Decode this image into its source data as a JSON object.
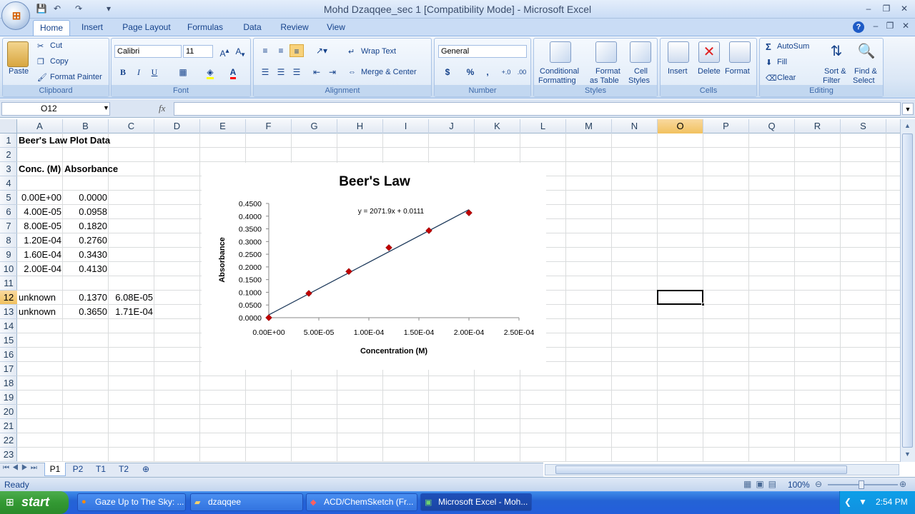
{
  "window": {
    "title": "Mohd Dzaqqee_sec 1  [Compatibility Mode] - Microsoft Excel"
  },
  "tabs": [
    "Home",
    "Insert",
    "Page Layout",
    "Formulas",
    "Data",
    "Review",
    "View"
  ],
  "ribbon": {
    "clipboard": {
      "label": "Clipboard",
      "paste": "Paste",
      "cut": "Cut",
      "copy": "Copy",
      "format_painter": "Format Painter"
    },
    "font": {
      "label": "Font",
      "name": "Calibri",
      "size": "11",
      "bold": "B",
      "italic": "I",
      "underline": "U"
    },
    "alignment": {
      "label": "Alignment",
      "wrap": "Wrap Text",
      "merge": "Merge & Center"
    },
    "number": {
      "label": "Number",
      "format": "General",
      "currency": "$",
      "percent": "%",
      "comma": ","
    },
    "styles": {
      "label": "Styles",
      "conditional1": "Conditional",
      "conditional2": "Formatting",
      "format_table1": "Format",
      "format_table2": "as Table",
      "cell_styles1": "Cell",
      "cell_styles2": "Styles"
    },
    "cells": {
      "label": "Cells",
      "insert": "Insert",
      "delete": "Delete",
      "format": "Format"
    },
    "editing": {
      "label": "Editing",
      "autosum": "AutoSum",
      "fill": "Fill",
      "clear": "Clear",
      "sort1": "Sort &",
      "sort2": "Filter",
      "find1": "Find &",
      "find2": "Select"
    }
  },
  "formula_bar": {
    "name_box": "O12",
    "fx": "fx",
    "value": ""
  },
  "columns": [
    "A",
    "B",
    "C",
    "D",
    "E",
    "F",
    "G",
    "H",
    "I",
    "J",
    "K",
    "L",
    "M",
    "N",
    "O",
    "P",
    "Q",
    "R",
    "S"
  ],
  "rows": [
    "1",
    "2",
    "3",
    "4",
    "5",
    "6",
    "7",
    "8",
    "9",
    "10",
    "11",
    "12",
    "13",
    "14",
    "15",
    "16",
    "17",
    "18",
    "19",
    "20",
    "21",
    "22",
    "23"
  ],
  "cells": {
    "a1": "Beer's Law Plot Data",
    "a3": "Conc. (M)",
    "b3": "Absorbance",
    "a5": "0.00E+00",
    "b5": "0.0000",
    "a6": "4.00E-05",
    "b6": "0.0958",
    "a7": "8.00E-05",
    "b7": "0.1820",
    "a8": "1.20E-04",
    "b8": "0.2760",
    "a9": "1.60E-04",
    "b9": "0.3430",
    "a10": "2.00E-04",
    "b10": "0.4130",
    "a12": "unknown",
    "b12": "0.1370",
    "c12": "6.08E-05",
    "a13": "unknown",
    "b13": "0.3650",
    "c13": "1.71E-04"
  },
  "chart_data": {
    "type": "scatter",
    "title": "Beer's Law",
    "xlabel": "Concentration (M)",
    "ylabel": "Absorbance",
    "x": [
      0,
      4e-05,
      8e-05,
      0.00012,
      0.00016,
      0.0002
    ],
    "y": [
      0,
      0.0958,
      0.182,
      0.276,
      0.343,
      0.413
    ],
    "xlim": [
      0,
      0.00025
    ],
    "ylim": [
      0,
      0.45
    ],
    "xticks": [
      "0.00E+00",
      "5.00E-05",
      "1.00E-04",
      "1.50E-04",
      "2.00E-04",
      "2.50E-04"
    ],
    "yticks": [
      "0.0000",
      "0.0500",
      "0.1000",
      "0.1500",
      "0.2000",
      "0.2500",
      "0.3000",
      "0.3500",
      "0.4000",
      "0.4500"
    ],
    "trendline": {
      "slope": 2071.9,
      "intercept": 0.0111,
      "label": "y = 2071.9x + 0.0111"
    },
    "marker_color": "#c00000",
    "line_color": "#1f3b5c",
    "grid": false,
    "legend": "none"
  },
  "sheet_tabs": [
    "P1",
    "P2",
    "T1",
    "T2"
  ],
  "status": {
    "text": "Ready",
    "zoom": "100%"
  },
  "taskbar": {
    "start": "start",
    "items": [
      "Gaze Up to The Sky: ...",
      "dzaqqee",
      "ACD/ChemSketch (Fr...",
      "Microsoft Excel - Moh..."
    ],
    "time": "2:54 PM"
  }
}
